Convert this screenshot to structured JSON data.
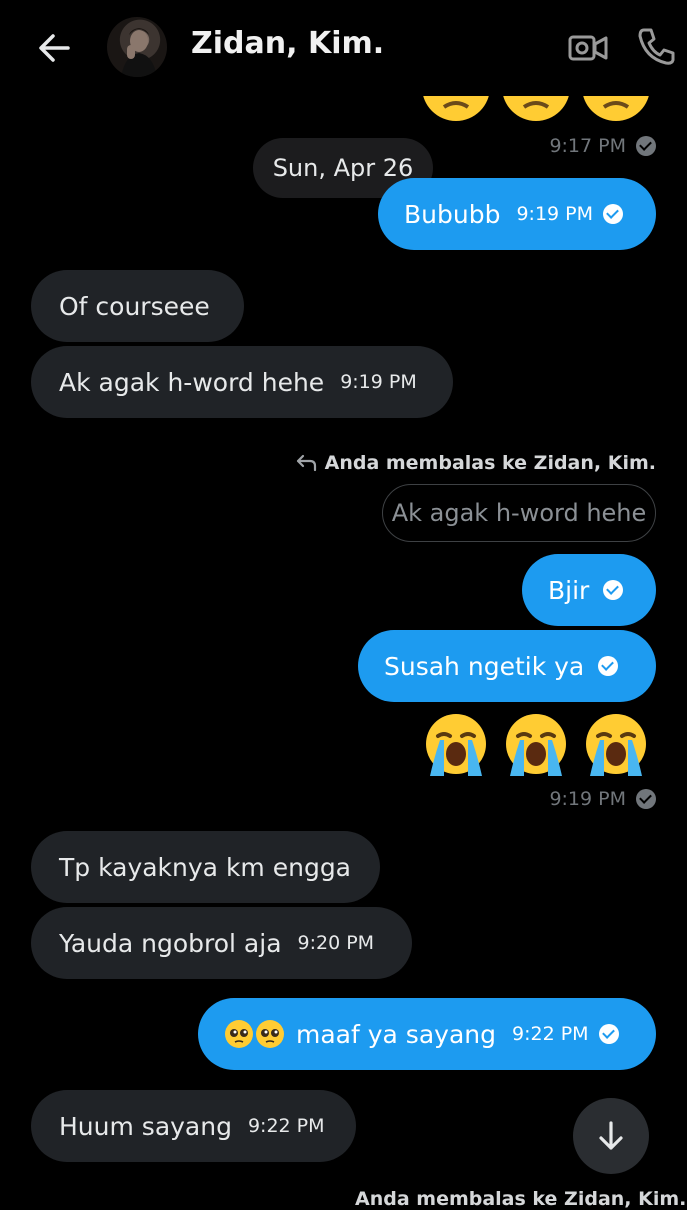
{
  "header": {
    "title": "Zidan, Kim."
  },
  "icons": {
    "back": "arrow-left-icon",
    "video": "video-camera-icon",
    "call": "phone-icon",
    "scroll": "arrow-down-icon"
  },
  "colors": {
    "background": "#000000",
    "outgoing": "#1d9bf0",
    "incoming": "#202327",
    "muted": "#71767b"
  },
  "top_time": "9:17 PM",
  "date_divider": "Sun, Apr 26",
  "messages": [
    {
      "dir": "out",
      "text": "Bububb",
      "time": "9:19 PM"
    },
    {
      "dir": "in",
      "text": "Of courseee"
    },
    {
      "dir": "in",
      "text": "Ak agak h-word hehe",
      "time": "9:19 PM"
    },
    {
      "dir": "reply_note",
      "text": "Anda membalas ke Zidan, Kim."
    },
    {
      "dir": "quote",
      "text": "Ak agak h-word hehe"
    },
    {
      "dir": "out",
      "text": "Bjir"
    },
    {
      "dir": "out",
      "text": "Susah ngetik ya"
    },
    {
      "dir": "out_emoji",
      "emoji": "loudly-crying-face x3",
      "time": "9:19 PM"
    },
    {
      "dir": "in",
      "text": "Tp kayaknya km engga"
    },
    {
      "dir": "in",
      "text": "Yauda ngobrol aja",
      "time": "9:20 PM"
    },
    {
      "dir": "out",
      "emoji": "pleading-face x2",
      "text": "maaf ya sayang",
      "time": "9:22 PM"
    },
    {
      "dir": "in",
      "text": "Huum sayang",
      "time": "9:22 PM"
    }
  ],
  "bottom_partial": "Anda membalas ke Zidan, Kim."
}
